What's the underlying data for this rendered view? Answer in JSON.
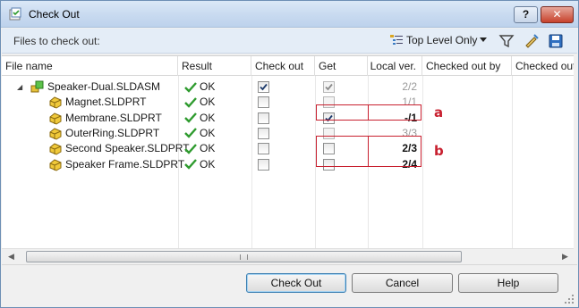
{
  "window": {
    "title": "Check Out",
    "help_label": "?",
    "close_label": "✕"
  },
  "toolbar": {
    "label": "Files to check out:",
    "filter_label": "Top Level Only",
    "icons": [
      "list-filter-icon",
      "funnel-icon",
      "edit-pin-icon",
      "save-icon"
    ]
  },
  "columns": [
    "File name",
    "Result",
    "Check out",
    "Get",
    "Local ver.",
    "Checked out by",
    "Checked out"
  ],
  "rows": [
    {
      "name": "Speaker-Dual.SLDASM",
      "type": "assembly",
      "result": "OK",
      "checkout": true,
      "get": true,
      "get_dim": true,
      "ver": "2/2",
      "ver_style": "dim"
    },
    {
      "name": "Magnet.SLDPRT",
      "type": "part",
      "result": "OK",
      "checkout": false,
      "get": false,
      "get_dim": true,
      "ver": "1/1",
      "ver_style": "dim"
    },
    {
      "name": "Membrane.SLDPRT",
      "type": "part",
      "result": "OK",
      "checkout": false,
      "get": true,
      "get_dim": false,
      "ver": "-/1",
      "ver_style": "bold"
    },
    {
      "name": "OuterRing.SLDPRT",
      "type": "part",
      "result": "OK",
      "checkout": false,
      "get": false,
      "get_dim": true,
      "ver": "3/3",
      "ver_style": "dim"
    },
    {
      "name": "Second Speaker.SLDPRT",
      "type": "part",
      "result": "OK",
      "checkout": false,
      "get": false,
      "get_dim": false,
      "ver": "2/3",
      "ver_style": "bold"
    },
    {
      "name": "Speaker Frame.SLDPRT",
      "type": "part",
      "result": "OK",
      "checkout": false,
      "get": false,
      "get_dim": false,
      "ver": "2/4",
      "ver_style": "bold"
    }
  ],
  "annotations": {
    "a": "a",
    "b": "b"
  },
  "buttons": {
    "checkout": "Check Out",
    "cancel": "Cancel",
    "help": "Help"
  },
  "colors": {
    "highlight": "#c8202f",
    "ok_check": "#2f9b2f",
    "title_bar": "#c8daf0"
  }
}
